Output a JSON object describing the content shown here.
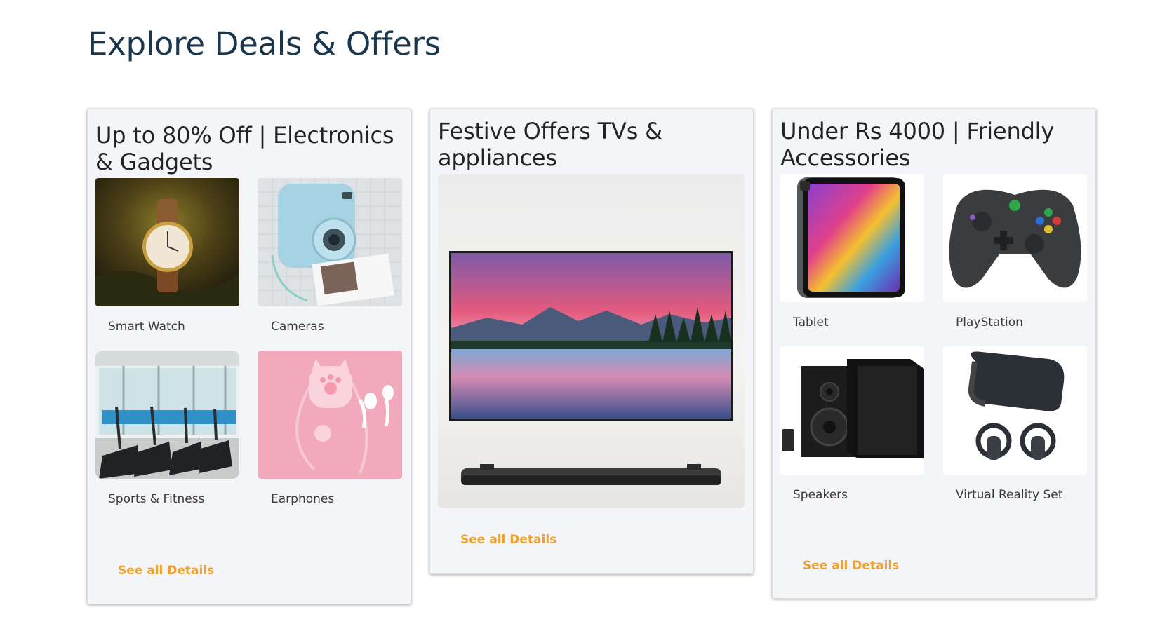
{
  "page": {
    "title": "Explore Deals & Offers"
  },
  "cards": [
    {
      "title": "Up to 80% Off | Electronics & Gadgets",
      "items": [
        {
          "label": "Smart Watch",
          "icon": "smart-watch-image"
        },
        {
          "label": "Cameras",
          "icon": "camera-image"
        },
        {
          "label": "Sports & Fitness",
          "icon": "treadmill-image"
        },
        {
          "label": "Earphones",
          "icon": "earphones-image"
        }
      ],
      "link": "See all Details"
    },
    {
      "title": "Festive Offers TVs & appliances",
      "image": "television-image",
      "link": "See all Details"
    },
    {
      "title": "Under Rs 4000 | Friendly Accessories",
      "items": [
        {
          "label": "Tablet",
          "icon": "tablet-image"
        },
        {
          "label": "PlayStation",
          "icon": "gamepad-image"
        },
        {
          "label": "Speakers",
          "icon": "speakers-image"
        },
        {
          "label": "Virtual Reality Set",
          "icon": "vr-headset-image"
        }
      ],
      "link": "See all Details"
    }
  ],
  "colors": {
    "title": "#19364d",
    "card_bg": "#f4f5f9",
    "link": "#f0a12c",
    "label": "#3a3a3a"
  }
}
